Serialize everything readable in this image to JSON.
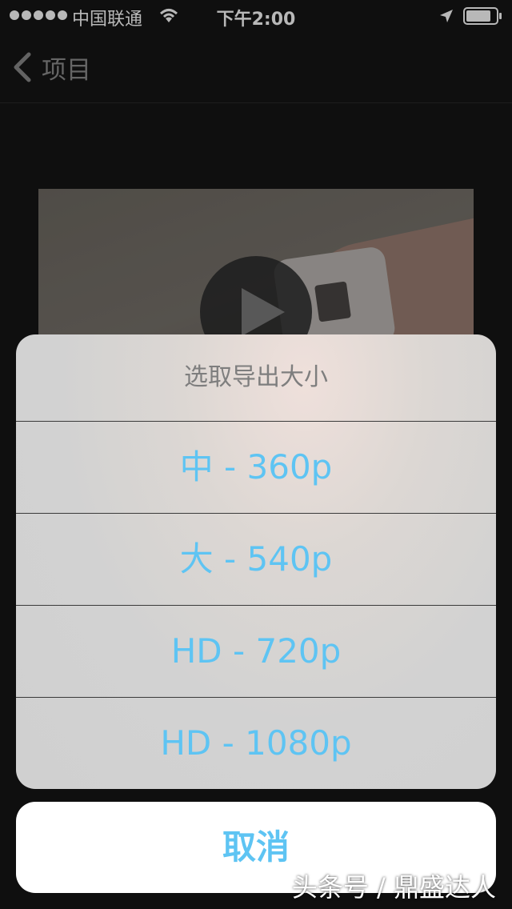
{
  "status_bar": {
    "carrier": "中国联通",
    "time": "下午2:00"
  },
  "nav": {
    "back_label": "项目"
  },
  "action_sheet": {
    "title": "选取导出大小",
    "options": [
      {
        "label": "中 - 360p"
      },
      {
        "label": "大 - 540p"
      },
      {
        "label": "HD - 720p"
      },
      {
        "label": "HD - 1080p"
      }
    ],
    "cancel_label": "取消"
  },
  "watermark": "头条号 / 鼎盛达人",
  "colors": {
    "accent": "#5ec4f3",
    "background": "#151515"
  }
}
